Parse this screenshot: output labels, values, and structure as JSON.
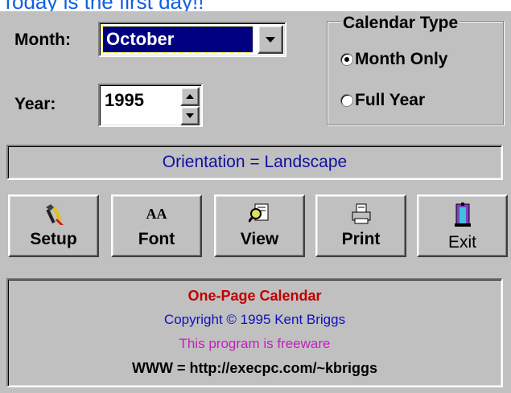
{
  "banner": {
    "text": "Today is the first day!!"
  },
  "month": {
    "label": "Month:",
    "value": "October"
  },
  "year": {
    "label": "Year:",
    "value": "1995"
  },
  "calendar_type": {
    "title": "Calendar Type",
    "options": [
      {
        "label": "Month Only",
        "selected": true
      },
      {
        "label": "Full Year",
        "selected": false
      }
    ]
  },
  "orientation": {
    "text": "Orientation = Landscape"
  },
  "toolbar": {
    "setup": {
      "label": "Setup",
      "icon": "tools-icon"
    },
    "font": {
      "label": "Font",
      "icon": "font-icon",
      "glyph": "AA"
    },
    "view": {
      "label": "View",
      "icon": "magnifier-icon"
    },
    "print": {
      "label": "Print",
      "icon": "printer-icon"
    },
    "exit": {
      "label": "Exit",
      "icon": "door-exit-icon"
    }
  },
  "about": {
    "title": "One-Page Calendar",
    "copyright": "Copyright © 1995 Kent Briggs",
    "freeware": "This program is freeware",
    "www": "WWW = http://execpc.com/~kbriggs"
  },
  "colors": {
    "banner": "#1060e0",
    "title": "#c00000",
    "copyright": "#1010c0",
    "freeware": "#c020c0",
    "www": "#000000",
    "orientation_text": "#1010a0",
    "selection": "#000080"
  }
}
